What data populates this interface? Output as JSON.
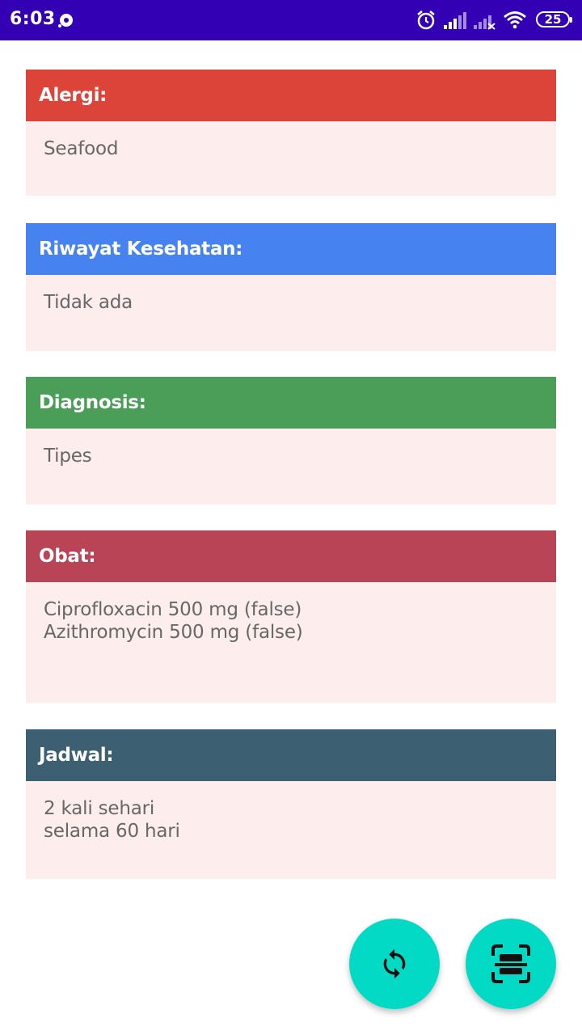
{
  "status_bar": {
    "time": "6:03",
    "battery": "25",
    "background": "#3300b3",
    "icons": [
      "media-icon",
      "alarm-icon",
      "signal-icon",
      "signal-no-service-icon",
      "wifi-icon",
      "battery-icon"
    ]
  },
  "cards": [
    {
      "title": "Alergi:",
      "content": "Seafood",
      "color": "#dc443a"
    },
    {
      "title": "Riwayat Kesehatan:",
      "content": "Tidak ada",
      "color": "#4683f0"
    },
    {
      "title": "Diagnosis:",
      "content": "Tipes",
      "color": "#4a9e57"
    },
    {
      "title": "Obat:",
      "content": "Ciprofloxacin 500 mg (false)\nAzithromycin 500 mg (false)",
      "color": "#b94455"
    },
    {
      "title": "Jadwal:",
      "content": "2 kali sehari\nselama 60 hari",
      "color": "#3c6072"
    }
  ],
  "card_body_color": "#fdeeed",
  "fabs": [
    {
      "icon": "refresh-icon"
    },
    {
      "icon": "scan-icon"
    }
  ],
  "fab_color": "#03dac5"
}
